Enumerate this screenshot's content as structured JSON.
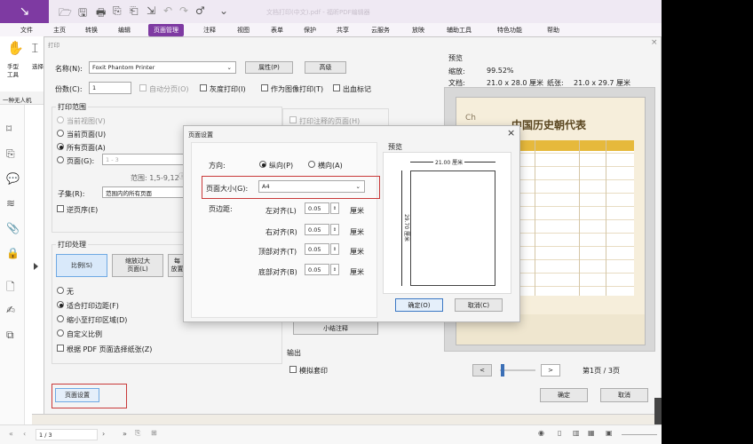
{
  "titlebar": {
    "title": "文档打印(中文).pdf - 福昕PDF编辑器",
    "logo_letter": "↘"
  },
  "menu": [
    "文件",
    "主页",
    "转换",
    "编辑",
    "页面管理",
    "注释",
    "视图",
    "表单",
    "保护",
    "共享",
    "云服务",
    "放映",
    "辅助工具",
    "特色功能",
    "帮助"
  ],
  "active_menu": "页面管理",
  "left_tools": {
    "hand": "手型",
    "hand2": "工具",
    "select": "选择"
  },
  "doc_tab": "一种无人机",
  "print_dialog": {
    "title": "打印",
    "name_label": "名称(N):",
    "printer": "Foxit Phantom Printer",
    "properties_btn": "属性(P)",
    "advanced_btn": "高级",
    "copies_label": "份数(C):",
    "copies": "1",
    "collate": "自动分页(O)",
    "grayscale": "灰度打印(I)",
    "as_image": "作为图像打印(T)",
    "bleed": "出血标记",
    "range_title": "打印范围",
    "current_view": "当前视图(V)",
    "current_page": "当前页面(U)",
    "all_pages": "所有页面(A)",
    "pages": "页面(G):",
    "pages_value": "1 - 3",
    "example": "范围: 1,5-9,12",
    "subset_label": "子集(R):",
    "subset_value": "范围内的所有页面",
    "reverse": "逆页序(E)",
    "annot": "打印注释的页面(H)",
    "handling_title": "打印处理",
    "scale_btn": "比例(S)",
    "fit_btn": "缩放过大\n页面(L)",
    "multi_btn": "每\n放置",
    "none": "无",
    "fit_margin": "适合打印边距(F)",
    "shrink": "缩小至打印区域(D)",
    "custom": "自定义比例",
    "choose_paper": "根据 PDF 页面选择纸张(Z)",
    "summary_btn": "小结注释",
    "output_title": "输出",
    "simulate": "模拟套印",
    "page_setup_btn": "页面设置",
    "ok": "确定",
    "cancel": "取消",
    "preview_title": "预览",
    "zoom_label": "缩放:",
    "zoom": "99.52%",
    "doc_label": "文档:",
    "doc_size": "21.0 x 28.0 厘米",
    "paper_label": "纸张:",
    "paper_size": "21.0 x 29.7 厘米",
    "page_indicator": "第1页 / 3页",
    "prev": "<",
    "next": ">",
    "preview_doc_title": "中国历史朝代表",
    "preview_ch": "Ch"
  },
  "page_setup": {
    "title": "页面设置",
    "orient_label": "方向:",
    "portrait": "纵向(P)",
    "landscape": "横向(A)",
    "size_label": "页面大小(G):",
    "size": "A4",
    "margins_label": "页边距:",
    "left": "左对齐(L)",
    "right": "右对齐(R)",
    "top": "顶部对齐(T)",
    "bottom": "底部对齐(B)",
    "left_v": "0.05",
    "right_v": "0.05",
    "top_v": "0.05",
    "bottom_v": "0.05",
    "unit": "厘米",
    "preview": "预览",
    "width_dim": "21.00 厘米",
    "height_dim": "29.70 厘米",
    "ok": "确定(O)",
    "cancel": "取消(C)"
  },
  "statusbar": {
    "page": "1 / 3"
  },
  "colors": {
    "purple": "#7e3aa2",
    "highlight": "#c93a3a",
    "accent_btn": "#6fa9e3"
  }
}
